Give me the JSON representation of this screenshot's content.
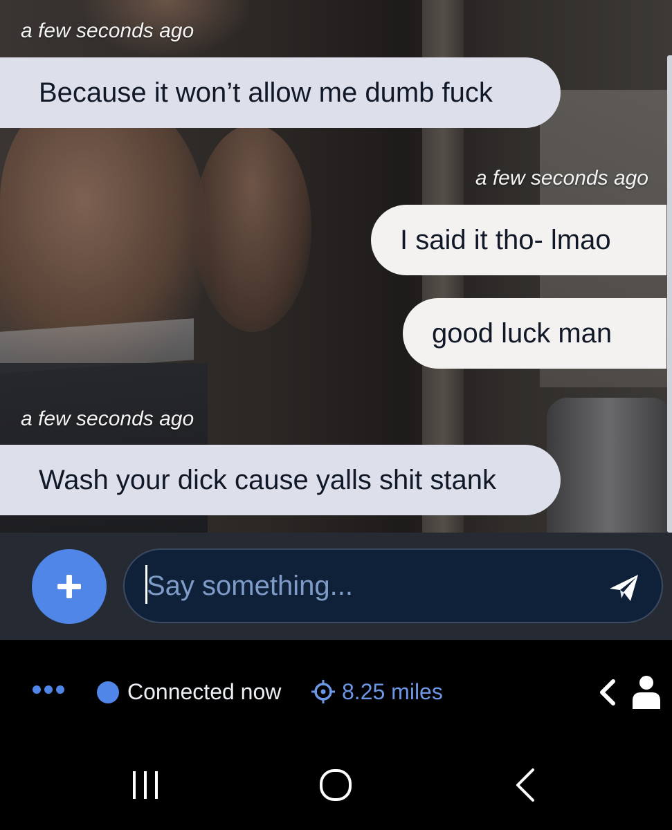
{
  "messages": [
    {
      "direction": "incoming",
      "timestamp": "a few seconds ago",
      "text": "Because it won’t allow me dumb fuck"
    },
    {
      "direction": "outgoing",
      "timestamp": "a few seconds ago",
      "text": "I said it tho- lmao"
    },
    {
      "direction": "outgoing",
      "text": "good luck man"
    },
    {
      "direction": "incoming",
      "timestamp": "a few seconds ago",
      "text": "Wash your dick cause yalls shit stank"
    }
  ],
  "composer": {
    "add_icon": "plus-icon",
    "placeholder": "Say something...",
    "value": "",
    "send_icon": "paper-plane-icon"
  },
  "status": {
    "more_icon": "more-dots-icon",
    "connection": "Connected now",
    "connection_color": "#4f86e8",
    "distance": "8.25 miles",
    "distance_icon": "crosshair-icon",
    "collapse_icon": "chevron-left-icon",
    "profile_icon": "person-icon"
  },
  "nav": {
    "recents_icon": "recents-icon",
    "home_icon": "home-icon",
    "back_icon": "back-icon"
  },
  "colors": {
    "accent": "#4f86e8",
    "incoming_bubble": "#dde0ea",
    "outgoing_bubble": "#f3f2f1",
    "input_bg": "#0f2139",
    "composer_bg": "#262b33"
  }
}
